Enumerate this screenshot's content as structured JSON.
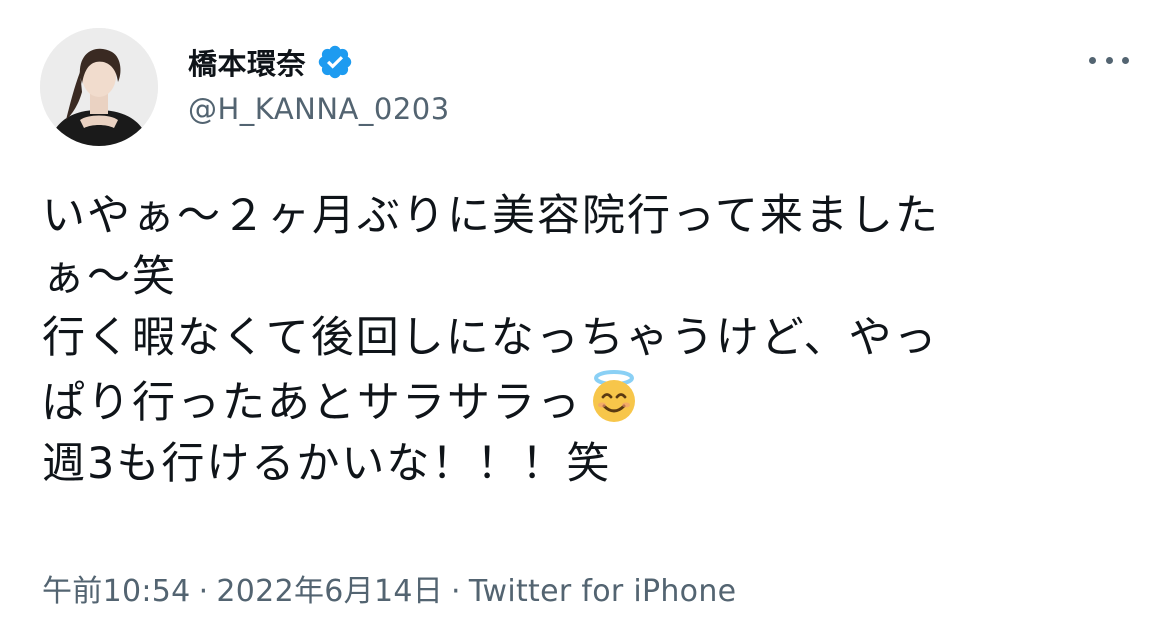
{
  "tweet": {
    "author": {
      "display_name": "橋本環奈",
      "handle": "@H_KANNA_0203",
      "verified": true
    },
    "text_lines": [
      "いやぁ〜２ヶ月ぶりに美容院行って来ました",
      "ぁ〜笑",
      "行く暇なくて後回しになっちゃうけど、やっ",
      "ぱり行ったあとサラサラっ",
      "週3も行けるかいな！！！笑"
    ],
    "emoji": "smiling-face-with-halo",
    "time": "午前10:54",
    "date": "2022年6月14日",
    "separator": "·",
    "source": "Twitter for iPhone"
  },
  "colors": {
    "text": "#0f1419",
    "secondary": "#536471",
    "verified_blue": "#1d9bf0",
    "halo": "#8ad0f5",
    "emoji_face": "#f7c64a"
  }
}
